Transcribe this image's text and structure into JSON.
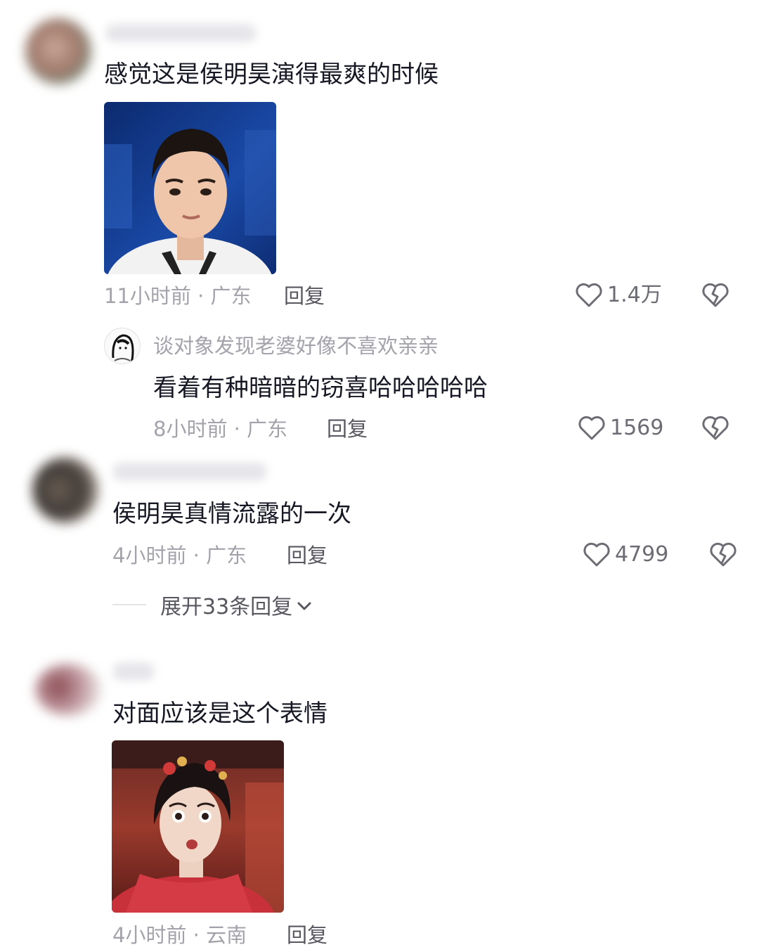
{
  "comments": [
    {
      "text": "感觉这是侯明昊演得最爽的时候",
      "meta": "11小时前 · 广东",
      "reply": "回复",
      "likes": "1.4万",
      "image": "photo-young-man-white-collar",
      "replies": [
        {
          "author": "谈对象发现老婆好像不喜欢亲亲",
          "text": "看着有种暗暗的窃喜哈哈哈哈哈",
          "meta": "8小时前 · 广东",
          "reply": "回复",
          "likes": "1569"
        }
      ]
    },
    {
      "text": "侯明昊真情流露的一次",
      "meta": "4小时前 · 广东",
      "reply": "回复",
      "likes": "4799",
      "expand": "展开33条回复"
    },
    {
      "text": "对面应该是这个表情",
      "meta": "4小时前 · 云南",
      "reply": "回复",
      "image": "photo-shocked-woman-costume"
    }
  ],
  "icons": {
    "like": "heart-outline-icon",
    "dislike": "broken-heart-icon",
    "expand": "chevron-down-icon"
  },
  "colors": {
    "text": "#161823",
    "meta": "#a3a3ab",
    "action": "#57575f"
  }
}
